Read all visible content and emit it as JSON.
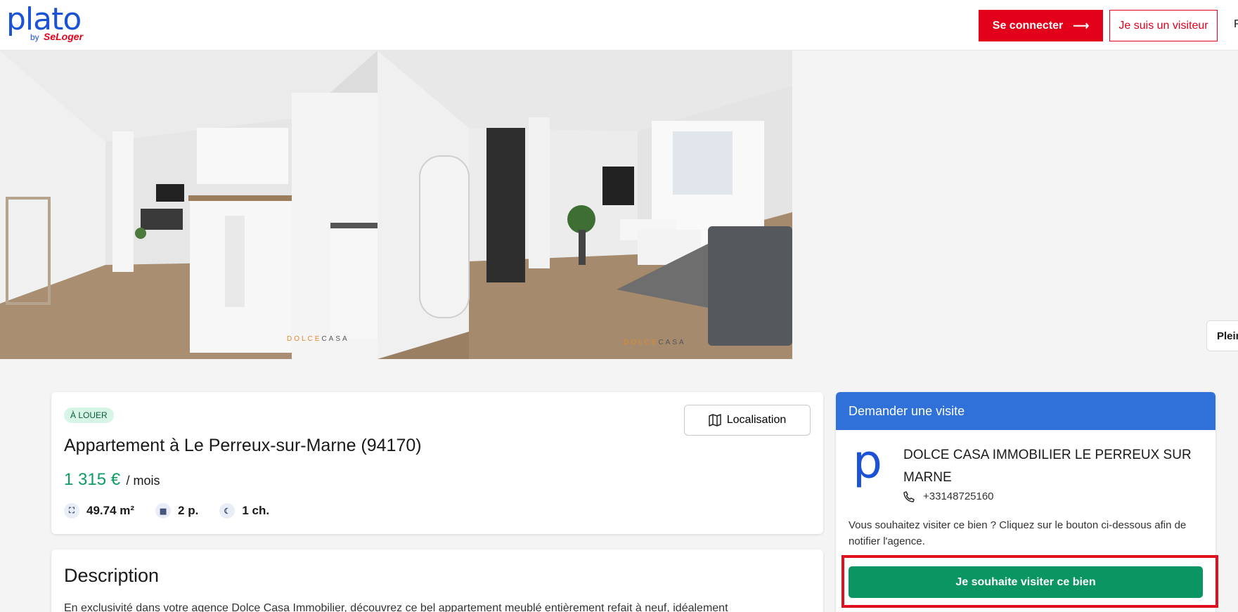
{
  "header": {
    "logo_text": "plato",
    "logo_by": "by",
    "logo_brand": "SeLoger",
    "login_label": "Se connecter",
    "visitor_label": "Je suis un visiteur",
    "cut_off_text": "F",
    "fullscreen_label": "Plein"
  },
  "gallery": {
    "photo_count": 2,
    "watermark_prefix": "DOLCE",
    "watermark_suffix": "CASA"
  },
  "listing": {
    "badge": "À LOUER",
    "location_label": "Localisation",
    "title": "Appartement à Le Perreux-sur-Marne (94170)",
    "price": "1 315 €",
    "price_period": "/ mois",
    "features": [
      {
        "icon": "area-icon",
        "value": "49.74 m²"
      },
      {
        "icon": "rooms-icon",
        "value": "2 p."
      },
      {
        "icon": "bedroom-icon",
        "value": "1 ch."
      }
    ]
  },
  "description": {
    "title": "Description",
    "text": "En exclusivité dans votre agence Dolce Casa Immobilier, découvrez ce bel appartement meublé entièrement refait à neuf, idéalement"
  },
  "visit": {
    "header": "Demander une visite",
    "agency_logo_letter": "p",
    "agency_name": "DOLCE CASA IMMOBILIER LE PERREUX SUR MARNE",
    "phone": "+33148725160",
    "text": "Vous souhaitez visiter ce bien ? Cliquez sur le bouton ci-dessous afin de notifier l'agence.",
    "button_label": "Je souhaite visiter ce bien"
  },
  "colors": {
    "brand_blue": "#1b52d6",
    "brand_red": "#e2001a",
    "price_green": "#0d9d63",
    "visit_header_blue": "#2f71d8",
    "visit_button_green": "#0a9562",
    "highlight_red": "#e0101e"
  }
}
